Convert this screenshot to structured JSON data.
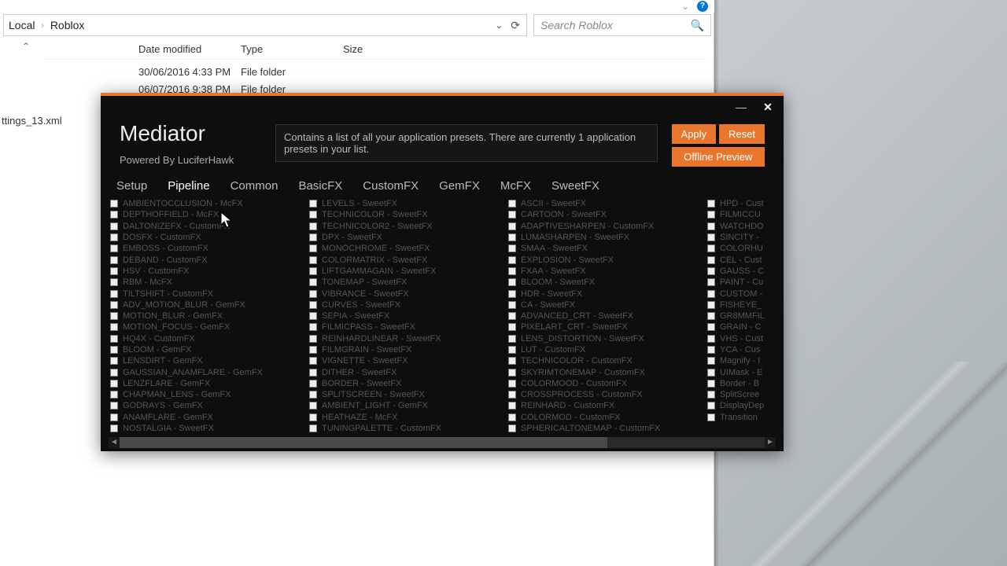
{
  "explorer": {
    "path_segments": [
      "Local",
      "Roblox"
    ],
    "search_placeholder": "Search Roblox",
    "columns": {
      "date": "Date modified",
      "type": "Type",
      "size": "Size"
    },
    "rows": [
      {
        "date": "30/06/2016 4:33 PM",
        "type": "File folder"
      },
      {
        "date": "06/07/2016 9:38 PM",
        "type": "File folder"
      }
    ],
    "left_file": "ttings_13.xml"
  },
  "mediator": {
    "title": "Mediator",
    "subtitle": "Powered By LuciferHawk",
    "description": "Contains a list of all your application presets. There are currently 1 application presets in your list.",
    "buttons": {
      "apply": "Apply",
      "reset": "Reset",
      "offline": "Offline Preview"
    },
    "tabs": [
      "Setup",
      "Pipeline",
      "Common",
      "BasicFX",
      "CustomFX",
      "GemFX",
      "McFX",
      "SweetFX"
    ],
    "active_tab": 1,
    "columns": [
      [
        "AMBIENTOCCLUSION - McFX",
        "DEPTHOFFIELD - McFX",
        "DALTONIZEFX - CustomFX",
        "DOSFX - CustomFX",
        "EMBOSS - CustomFX",
        "DEBAND - CustomFX",
        "HSV - CustomFX",
        "RBM - McFX",
        "TILTSHIFT - CustomFX",
        "ADV_MOTION_BLUR - GemFX",
        "MOTION_BLUR - GemFX",
        "MOTION_FOCUS - GemFX",
        "HQ4X - CustomFX",
        "BLOOM - GemFX",
        "LENSDIRT - GemFX",
        "GAUSSIAN_ANAMFLARE - GemFX",
        "LENZFLARE - GemFX",
        "CHAPMAN_LENS - GemFX",
        "GODRAYS - GemFX",
        "ANAMFLARE - GemFX",
        "NOSTALGIA - SweetFX"
      ],
      [
        "LEVELS - SweetFX",
        "TECHNICOLOR - SweetFX",
        "TECHNICOLOR2 - SweetFX",
        "DPX - SweetFX",
        "MONOCHROME - SweetFX",
        "COLORMATRIX - SweetFX",
        "LIFTGAMMAGAIN - SweetFX",
        "TONEMAP - SweetFX",
        "VIBRANCE - SweetFX",
        "CURVES - SweetFX",
        "SEPIA - SweetFX",
        "FILMICPASS - SweetFX",
        "REINHARDLINEAR - SweetFX",
        "FILMGRAIN - SweetFX",
        "VIGNETTE - SweetFX",
        "DITHER - SweetFX",
        "BORDER - SweetFX",
        "SPLITSCREEN - SweetFX",
        "AMBIENT_LIGHT - GemFX",
        "HEATHAZE - McFX",
        "TUNINGPALETTE - CustomFX"
      ],
      [
        "ASCII - SweetFX",
        "CARTOON - SweetFX",
        "ADAPTIVESHARPEN - CustomFX",
        "LUMASHARPEN - SweetFX",
        "SMAA - SweetFX",
        "EXPLOSION - SweetFX",
        "FXAA - SweetFX",
        "BLOOM - SweetFX",
        "HDR - SweetFX",
        "CA - SweetFX",
        "ADVANCED_CRT - SweetFX",
        "PIXELART_CRT - SweetFX",
        "LENS_DISTORTION - SweetFX",
        "LUT - CustomFX",
        "TECHNICOLOR - CustomFX",
        "SKYRIMTONEMAP - CustomFX",
        "COLORMOOD - CustomFX",
        "CROSSPROCESS - CustomFX",
        "REINHARD - CustomFX",
        "COLORMOD - CustomFX",
        "SPHERICALTONEMAP - CustomFX"
      ],
      [
        "HPD - Cust",
        "FILMICCU",
        "WATCHDO",
        "SINCITY -",
        "COLORHU",
        "CEL - Cust",
        "GAUSS - C",
        "PAINT - Cu",
        "CUSTOM -",
        "FISHEYE_",
        "GR8MMFIL",
        "GRAIN - C",
        "VHS - Cust",
        "YCA - Cus",
        "Magnify - I",
        "UIMask - E",
        "Border - B",
        "SplitScree",
        "DisplayDep",
        "Transition"
      ]
    ]
  }
}
